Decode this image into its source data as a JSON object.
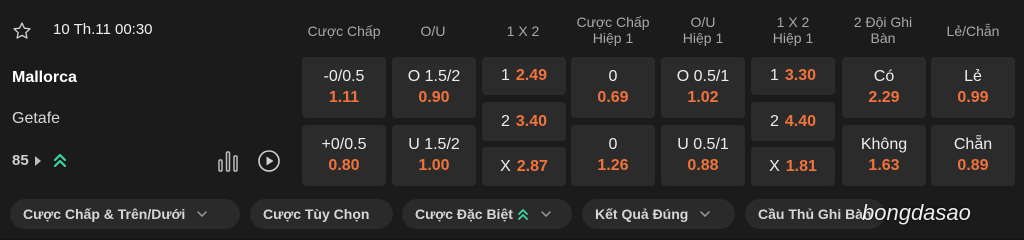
{
  "match": {
    "datetime": "10 Th.11 00:30",
    "home_team": "Mallorca",
    "away_team": "Getafe",
    "markets_count": "85"
  },
  "headers": {
    "handicap": "Cược Chấp",
    "ou": "O/U",
    "x12": "1 X 2",
    "handicap_h1_l1": "Cược Chấp",
    "handicap_h1_l2": "Hiệp 1",
    "ou_h1_l1": "O/U",
    "ou_h1_l2": "Hiệp 1",
    "x12_h1_l1": "1 X 2",
    "x12_h1_l2": "Hiệp 1",
    "btts_l1": "2 Đội Ghi",
    "btts_l2": "Bàn",
    "oddeven": "Lẻ/Chẵn"
  },
  "odds": {
    "handicap": [
      {
        "line": "-0/0.5",
        "odds": "1.11"
      },
      {
        "line": "+0/0.5",
        "odds": "0.80"
      }
    ],
    "ou": [
      {
        "line": "O 1.5/2",
        "odds": "0.90"
      },
      {
        "line": "U 1.5/2",
        "odds": "1.00"
      }
    ],
    "x12": [
      {
        "label": "1",
        "odds": "2.49"
      },
      {
        "label": "2",
        "odds": "3.40"
      },
      {
        "label": "X",
        "odds": "2.87"
      }
    ],
    "handicap_h1": [
      {
        "line": "0",
        "odds": "0.69"
      },
      {
        "line": "0",
        "odds": "1.26"
      }
    ],
    "ou_h1": [
      {
        "line": "O 0.5/1",
        "odds": "1.02"
      },
      {
        "line": "U 0.5/1",
        "odds": "0.88"
      }
    ],
    "x12_h1": [
      {
        "label": "1",
        "odds": "3.30"
      },
      {
        "label": "2",
        "odds": "4.40"
      },
      {
        "label": "X",
        "odds": "1.81"
      }
    ],
    "btts": [
      {
        "line": "Có",
        "odds": "2.29"
      },
      {
        "line": "Không",
        "odds": "1.63"
      }
    ],
    "oddeven": [
      {
        "line": "Lẻ",
        "odds": "0.99"
      },
      {
        "line": "Chẵn",
        "odds": "0.89"
      }
    ]
  },
  "tabs": [
    {
      "label": "Cược Chấp & Trên/Dưới"
    },
    {
      "label": "Cược Tùy Chọn"
    },
    {
      "label": "Cược Đặc Biệt"
    },
    {
      "label": "Kết Quả Đúng"
    },
    {
      "label": "Cầu Thủ Ghi Bàn"
    }
  ],
  "watermark": "bongdasao",
  "colors": {
    "odds": "#f0733c",
    "accent_green": "#3fd1a0",
    "cell_bg": "#2b2b2b",
    "panel_bg": "#1b1b1b"
  },
  "icons": {
    "favorite": "star-outline-icon",
    "more_markets": "caret-right-icon",
    "trend": "double-chevron-up-icon",
    "stats": "bar-chart-icon",
    "video": "play-circle-icon",
    "dropdown": "chevron-down-icon"
  }
}
